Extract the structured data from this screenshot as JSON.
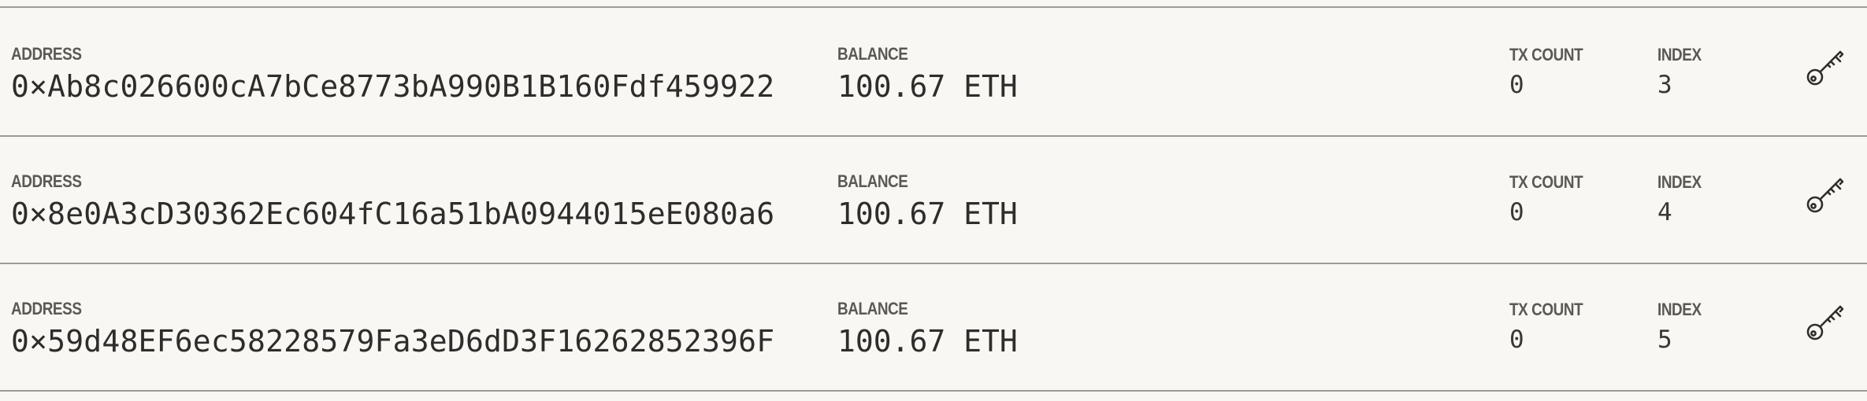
{
  "labels": {
    "address": "ADDRESS",
    "balance": "BALANCE",
    "tx_count": "TX COUNT",
    "index": "INDEX"
  },
  "icons": {
    "key": "key-icon"
  },
  "accounts": [
    {
      "address": "0×Ab8c026600cA7bCe8773bA990B1B160Fdf459922",
      "balance": "100.67 ETH",
      "tx_count": "0",
      "index": "3"
    },
    {
      "address": "0×8e0A3cD30362Ec604fC16a51bA0944015eE080a6",
      "balance": "100.67 ETH",
      "tx_count": "0",
      "index": "4"
    },
    {
      "address": "0×59d48EF6ec58228579Fa3eD6dD3F16262852396F",
      "balance": "100.67 ETH",
      "tx_count": "0",
      "index": "5"
    }
  ]
}
